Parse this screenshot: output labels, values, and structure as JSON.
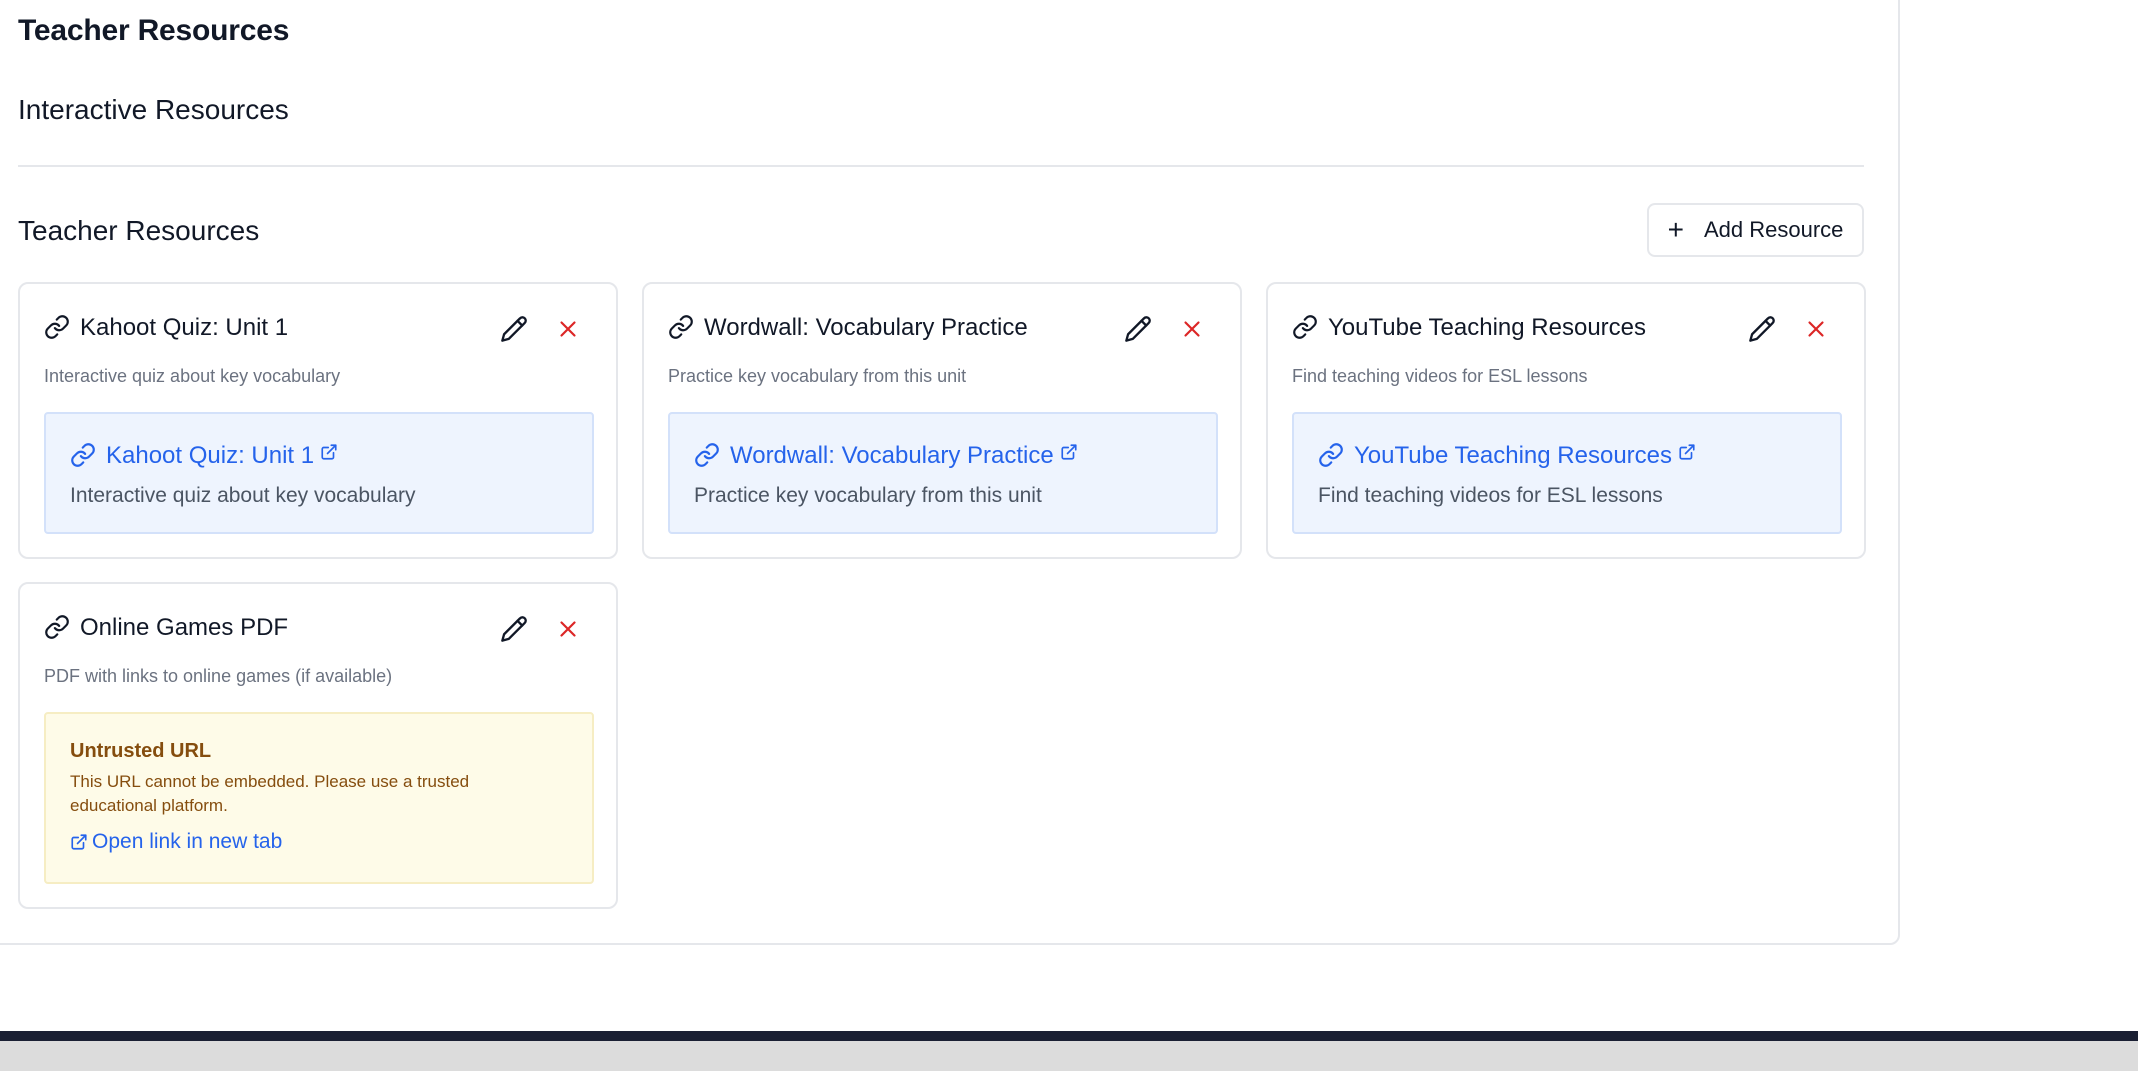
{
  "page": {
    "title": "Teacher Resources",
    "interactive_title": "Interactive Resources",
    "section_title": "Teacher Resources",
    "add_button_label": "Add Resource"
  },
  "resources": [
    {
      "title": "Kahoot Quiz: Unit 1",
      "description": "Interactive quiz about key vocabulary",
      "link_title": "Kahoot Quiz: Unit 1",
      "link_description": "Interactive quiz about key vocabulary",
      "status": "trusted"
    },
    {
      "title": "Wordwall: Vocabulary Practice",
      "description": "Practice key vocabulary from this unit",
      "link_title": "Wordwall: Vocabulary Practice",
      "link_description": "Practice key vocabulary from this unit",
      "status": "trusted"
    },
    {
      "title": "YouTube Teaching Resources",
      "description": "Find teaching videos for ESL lessons",
      "link_title": "YouTube Teaching Resources",
      "link_description": "Find teaching videos for ESL lessons",
      "status": "trusted"
    },
    {
      "title": "Online Games PDF",
      "description": "PDF with links to online games (if available)",
      "status": "untrusted",
      "warning_title": "Untrusted URL",
      "warning_message": "This URL cannot be embedded. Please use a trusted educational platform.",
      "open_link_label": "Open link in new tab"
    }
  ],
  "icons": {
    "card": "link-icon",
    "edit": "pencil-icon",
    "delete": "close-icon",
    "add": "plus-icon",
    "external": "external-link-icon"
  },
  "colors": {
    "link": "#2563eb",
    "delete": "#dc2626",
    "link_box_bg": "#eef4fe",
    "warning_bg": "#fefbe8",
    "warning_text": "#854d0e"
  }
}
